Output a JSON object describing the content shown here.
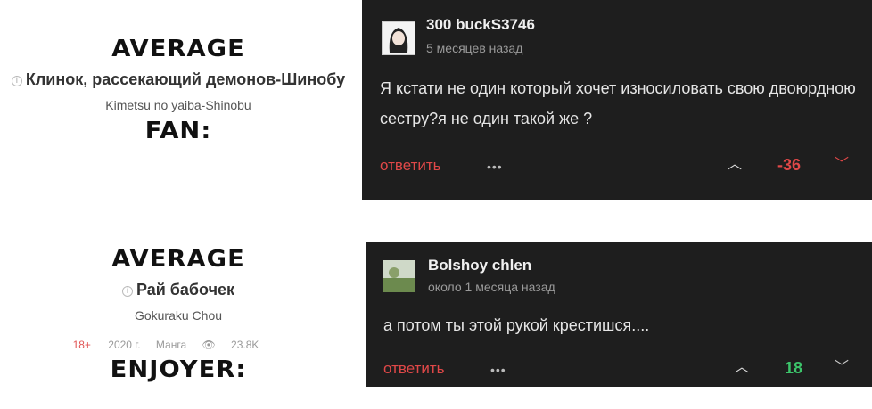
{
  "top": {
    "label_average": "AVERAGE",
    "title": "Клинок, рассекающий демонов-Шинобу",
    "subtitle": "Kimetsu no yaiba-Shinobu",
    "label_fan": "FAN:",
    "comment": {
      "author": "300 buckS3746",
      "time": "5 месяцев назад",
      "text": "Я кстати не один который хочет износиловать свою двоюрдною сестру?я не один такой же ?",
      "reply": "ответить",
      "dots": "•••",
      "up": "︿",
      "score": "-36",
      "down": "﹀",
      "score_color": "#e04848",
      "down_color": "#e04848"
    }
  },
  "bottom": {
    "label_average": "AVERAGE",
    "title": "Рай бабочек",
    "subtitle": "Gokuraku Chou",
    "meta": {
      "age": "18+",
      "year": "2020 г.",
      "type": "Манга",
      "views": "23.8K"
    },
    "label_enjoyer": "ENJOYER:",
    "comment": {
      "author": "Bolshoy chlen",
      "time": "около 1 месяца назад",
      "text": "а потом ты этой рукой крестишся....",
      "reply": "ответить",
      "dots": "•••",
      "up": "︿",
      "score": "18",
      "down": "﹀",
      "score_color": "#3cc46a",
      "down_color": "#cccccc"
    }
  }
}
